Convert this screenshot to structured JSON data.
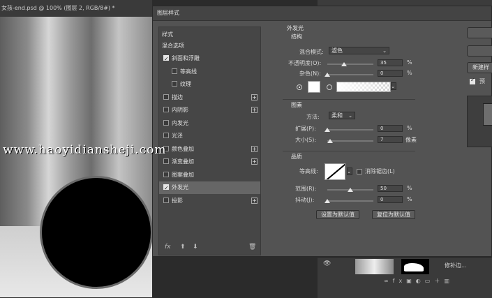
{
  "document": {
    "tab_title": "女孩-end.psd @ 100% (图层 2, RGB/8#) *"
  },
  "watermark": "www.haoyidiansheji.com",
  "dialog": {
    "title": "图层样式",
    "styles_header": "样式",
    "blending_options": "混合选项",
    "styles": [
      {
        "label": "斜面和浮雕",
        "checked": true,
        "plus": false
      },
      {
        "label": "等高线",
        "checked": false,
        "plus": false
      },
      {
        "label": "纹理",
        "checked": false,
        "plus": false
      },
      {
        "label": "描边",
        "checked": false,
        "plus": true
      },
      {
        "label": "内阴影",
        "checked": false,
        "plus": true
      },
      {
        "label": "内发光",
        "checked": false,
        "plus": false
      },
      {
        "label": "光泽",
        "checked": false,
        "plus": false
      },
      {
        "label": "颜色叠加",
        "checked": false,
        "plus": true
      },
      {
        "label": "渐变叠加",
        "checked": false,
        "plus": true
      },
      {
        "label": "图案叠加",
        "checked": false,
        "plus": false
      },
      {
        "label": "外发光",
        "checked": true,
        "plus": false
      },
      {
        "label": "投影",
        "checked": false,
        "plus": true
      }
    ],
    "bottom_icons": {
      "fx": "fx",
      "up": "⬆",
      "down": "⬇",
      "trash": "🗑"
    },
    "outer_glow": {
      "title": "外发光",
      "structure": {
        "header": "结构",
        "blend_mode_label": "混合模式:",
        "blend_mode": "滤色",
        "opacity_label": "不透明度(O):",
        "opacity": "35",
        "opacity_unit": "%",
        "noise_label": "杂色(N):",
        "noise": "0",
        "noise_unit": "%"
      },
      "elements": {
        "header": "图素",
        "method_label": "方法:",
        "method": "柔和",
        "spread_label": "扩展(P):",
        "spread": "0",
        "spread_unit": "%",
        "size_label": "大小(S):",
        "size": "7",
        "size_unit": "像素"
      },
      "quality": {
        "header": "品质",
        "contour_label": "等高线:",
        "anti_alias_label": "消除锯齿(L)",
        "range_label": "范围(R):",
        "range": "50",
        "range_unit": "%",
        "jitter_label": "抖动(J):",
        "jitter": "0",
        "jitter_unit": "%"
      },
      "reset_default": "设置为默认值",
      "restore_default": "复位为默认值"
    },
    "right_buttons": {
      "new_style": "新建样"
    },
    "preview_checked": true,
    "preview_label": "预"
  },
  "colors": {
    "glow_color": "#ffffff"
  },
  "layers_panel": {
    "layer_name": "修补边..."
  }
}
